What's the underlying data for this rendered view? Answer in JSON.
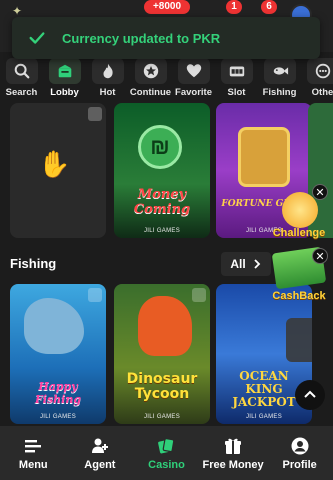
{
  "header": {
    "deposit_badge": "+8000",
    "notif_count_1": "1",
    "notif_count_2": "6"
  },
  "toast": {
    "message": "Currency updated to PKR",
    "icon": "check-icon",
    "color": "#34d17a"
  },
  "categories": [
    {
      "label": "Search",
      "icon": "search-icon"
    },
    {
      "label": "Lobby",
      "icon": "lobby-icon",
      "active": true
    },
    {
      "label": "Hot",
      "icon": "flame-icon"
    },
    {
      "label": "Continue",
      "icon": "star-badge-icon"
    },
    {
      "label": "Favorite",
      "icon": "heart-icon"
    },
    {
      "label": "Slot",
      "icon": "slot-machine-icon"
    },
    {
      "label": "Fishing",
      "icon": "fish-icon"
    },
    {
      "label": "Othe",
      "icon": "more-icon"
    }
  ],
  "row1": {
    "games": [
      {
        "title": "",
        "provider": ""
      },
      {
        "title": "Money Coming",
        "provider": "JILI GAMES"
      },
      {
        "title": "FORTUNE GEMS",
        "provider": "JILI GAMES"
      }
    ]
  },
  "widgets": {
    "challenge_label": "Challenge",
    "cashback_label": "CashBack"
  },
  "fishing": {
    "title": "Fishing",
    "all_label": "All",
    "games": [
      {
        "title": "Happy Fishing",
        "provider": "JILI GAMES"
      },
      {
        "title": "Dinosaur Tycoon",
        "provider": "JILI GAMES"
      },
      {
        "title": "OCEAN KING JACKPOT",
        "provider": "JILI GAMES"
      }
    ]
  },
  "bottom_nav": [
    {
      "label": "Menu",
      "icon": "menu-icon"
    },
    {
      "label": "Agent",
      "icon": "agent-icon"
    },
    {
      "label": "Casino",
      "icon": "casino-icon",
      "active": true
    },
    {
      "label": "Free Money",
      "icon": "gift-icon"
    },
    {
      "label": "Profile",
      "icon": "profile-icon"
    }
  ],
  "colors": {
    "accent": "#2fd07a",
    "background": "#1c1c1c",
    "widget_text": "#ffd33b"
  }
}
